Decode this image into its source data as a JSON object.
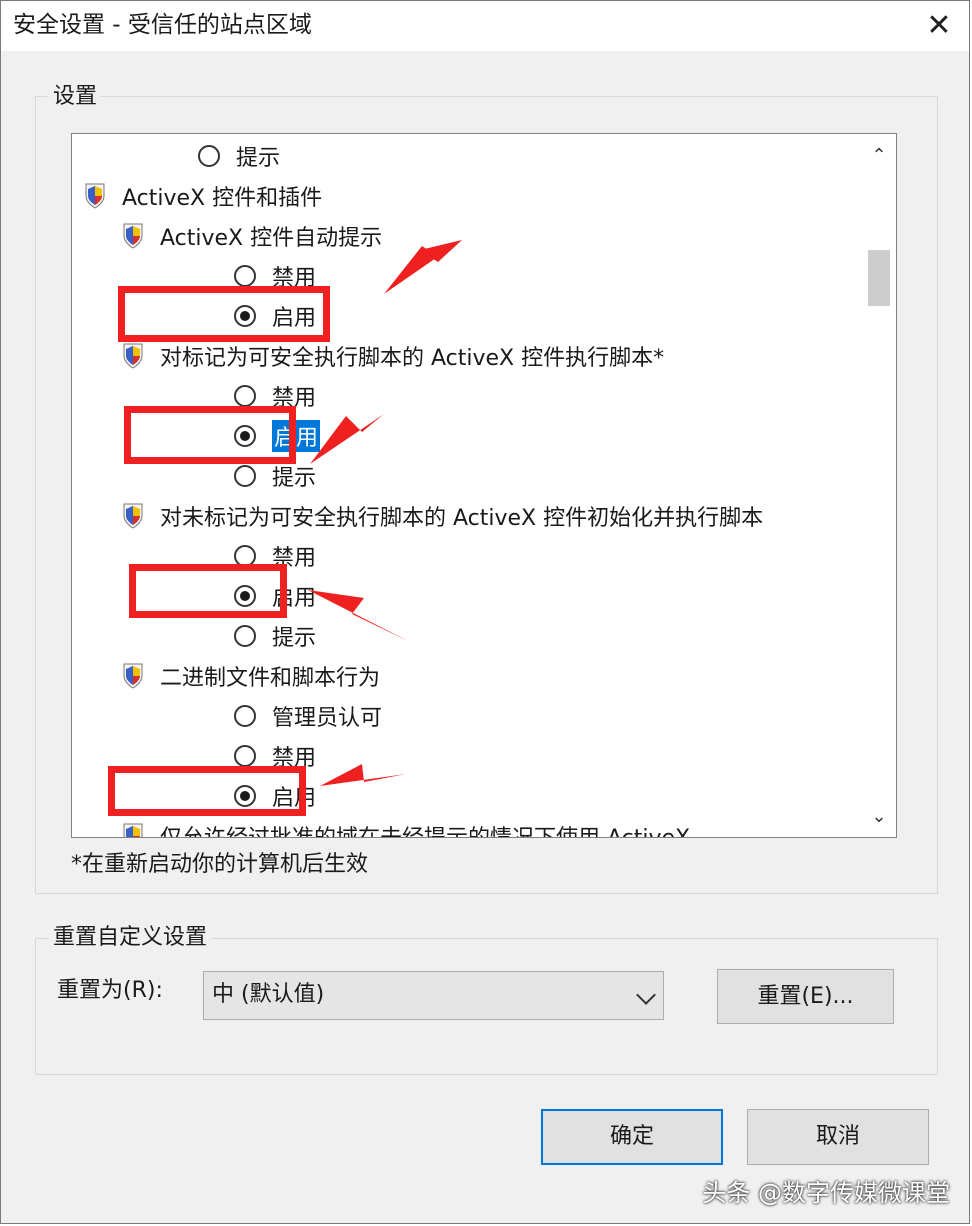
{
  "window": {
    "title": "安全设置 - 受信任的站点区域",
    "close_glyph": "✕"
  },
  "settings_group": {
    "label": "设置"
  },
  "tree": [
    {
      "type": "radio",
      "label": "提示",
      "checked": false,
      "indent": 1
    },
    {
      "type": "group",
      "label": "ActiveX 控件和插件",
      "indent": 0
    },
    {
      "type": "setting",
      "label": "ActiveX 控件自动提示",
      "indent": 1
    },
    {
      "type": "radio",
      "label": "禁用",
      "checked": false,
      "indent": 2
    },
    {
      "type": "radio",
      "label": "启用",
      "checked": true,
      "indent": 2
    },
    {
      "type": "setting",
      "label": "对标记为可安全执行脚本的 ActiveX 控件执行脚本*",
      "indent": 1
    },
    {
      "type": "radio",
      "label": "禁用",
      "checked": false,
      "indent": 2
    },
    {
      "type": "radio",
      "label": "启用",
      "checked": true,
      "indent": 2,
      "selected": true
    },
    {
      "type": "radio",
      "label": "提示",
      "checked": false,
      "indent": 2
    },
    {
      "type": "setting",
      "label": "对未标记为可安全执行脚本的 ActiveX 控件初始化并执行脚本",
      "indent": 1
    },
    {
      "type": "radio",
      "label": "禁用",
      "checked": false,
      "indent": 2
    },
    {
      "type": "radio",
      "label": "启用",
      "checked": true,
      "indent": 2
    },
    {
      "type": "radio",
      "label": "提示",
      "checked": false,
      "indent": 2
    },
    {
      "type": "setting",
      "label": "二进制文件和脚本行为",
      "indent": 1
    },
    {
      "type": "radio",
      "label": "管理员认可",
      "checked": false,
      "indent": 2
    },
    {
      "type": "radio",
      "label": "禁用",
      "checked": false,
      "indent": 2
    },
    {
      "type": "radio",
      "label": "启用",
      "checked": true,
      "indent": 2
    },
    {
      "type": "setting",
      "label": "仅允许经过批准的域在未经提示的情况下使用 ActiveX",
      "indent": 1
    }
  ],
  "scrollbar": {
    "up_glyph": "⌃",
    "down_glyph": "⌄"
  },
  "note": "*在重新启动你的计算机后生效",
  "reset_group": {
    "label": "重置自定义设置",
    "reset_to_label": "重置为(R):",
    "select_value": "中 (默认值)",
    "reset_button": "重置(E)..."
  },
  "footer": {
    "ok_button": "确定",
    "cancel_button": "取消"
  },
  "watermark": "头条 @数字传媒微课堂",
  "annotation_color": "#ef2020",
  "accent_color": "#0078d7"
}
